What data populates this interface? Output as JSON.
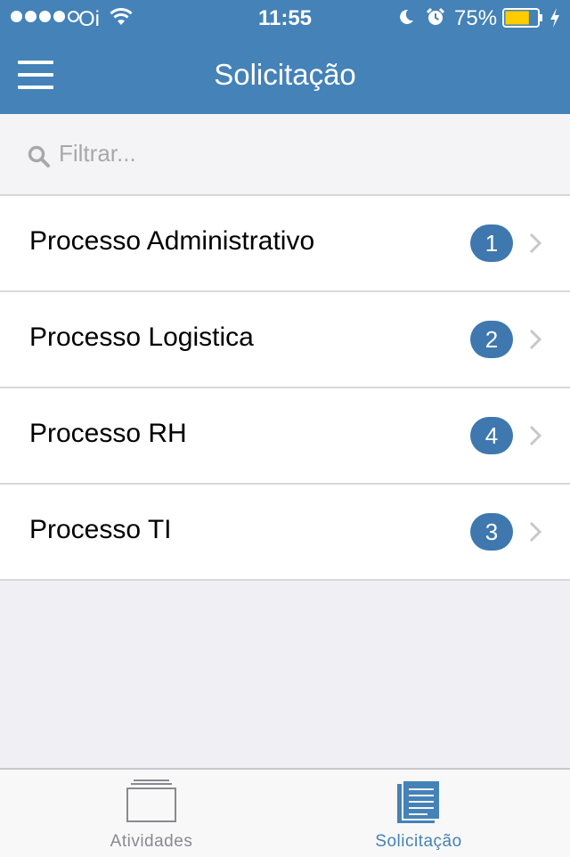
{
  "status_bar": {
    "carrier": "Oi",
    "time": "11:55",
    "battery_percent": "75%",
    "battery_level": 0.75,
    "signal_bars": 4,
    "signal_total": 5
  },
  "nav": {
    "title": "Solicitação",
    "menu_icon": "hamburger-menu-icon"
  },
  "search": {
    "placeholder": "Filtrar...",
    "value": "",
    "icon": "search-icon"
  },
  "list": {
    "items": [
      {
        "label": "Processo Administrativo",
        "count": "1"
      },
      {
        "label": "Processo Logistica",
        "count": "2"
      },
      {
        "label": "Processo RH",
        "count": "4"
      },
      {
        "label": "Processo TI",
        "count": "3"
      }
    ]
  },
  "tabs": [
    {
      "label": "Atividades",
      "icon": "stacked-cards-icon",
      "active": false
    },
    {
      "label": "Solicitação",
      "icon": "document-list-icon",
      "active": true
    }
  ],
  "colors": {
    "header": "#4482b8",
    "badge": "#3f78ae",
    "active_tab": "#4482b8",
    "inactive_tab": "#8a8a8e",
    "battery_fill": "#ffcc00",
    "background": "#efeff4"
  }
}
